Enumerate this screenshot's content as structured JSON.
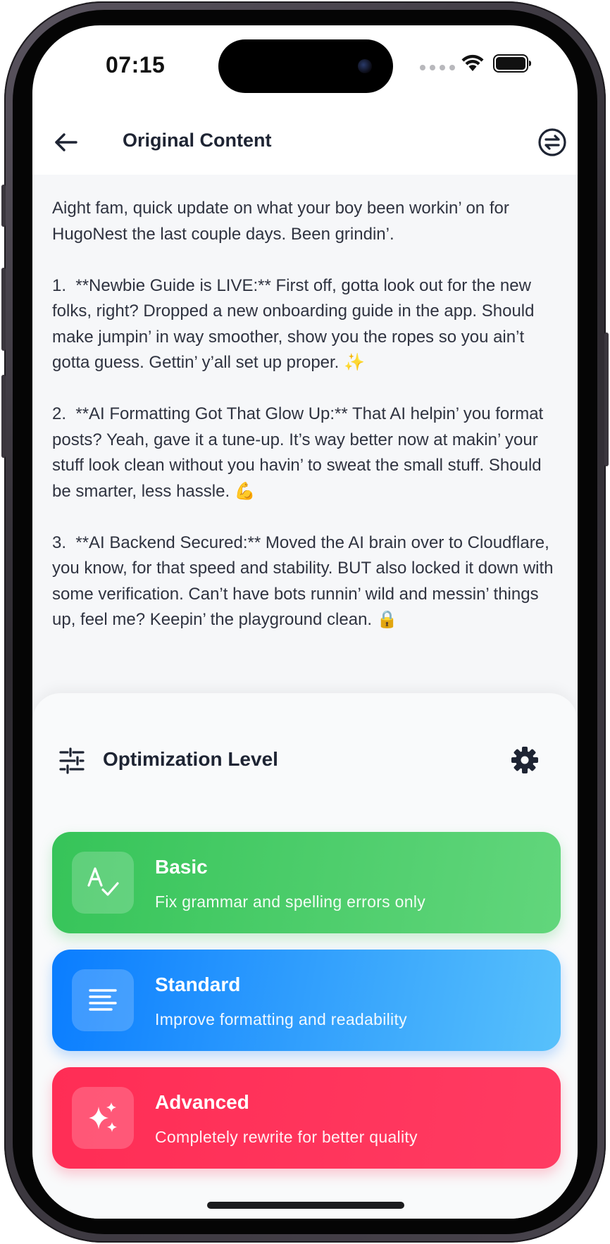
{
  "status_bar": {
    "time": "07:15",
    "icons": [
      "signal-dots-icon",
      "wifi-icon",
      "battery-icon"
    ]
  },
  "header": {
    "title": "Original Content",
    "back_icon": "arrow-left-icon",
    "action_icon": "swap-arrows-icon"
  },
  "content": {
    "text": "Aight fam, quick update on what your boy been workin’ on for HugoNest the last couple days. Been grindin’.\n\n1.  **Newbie Guide is LIVE:** First off, gotta look out for the new folks, right? Dropped a new onboarding guide in the app. Should make jumpin’ in way smoother, show you the ropes so you ain’t gotta guess. Gettin’ y’all set up proper. ✨\n\n2.  **AI Formatting Got That Glow Up:** That AI helpin’ you format posts? Yeah, gave it a tune-up. It’s way better now at makin’ your stuff look clean without you havin’ to sweat the small stuff. Should be smarter, less hassle. 💪\n\n3.  **AI Backend Secured:** Moved the AI brain over to Cloudflare, you know, for that speed and stability. BUT also locked it down with some verification. Can’t have bots runnin’ wild and messin’ things up, feel me? Keepin’ the playground clean. 🔒"
  },
  "optimization": {
    "title": "Optimization Level",
    "left_icon": "sliders-icon",
    "settings_icon": "gear-icon",
    "options": [
      {
        "title": "Basic",
        "description": "Fix grammar and spelling errors only",
        "icon": "spellcheck-icon",
        "color": "#34C759"
      },
      {
        "title": "Standard",
        "description": "Improve formatting and readability",
        "icon": "text-lines-icon",
        "color": "#007AFF"
      },
      {
        "title": "Advanced",
        "description": "Completely rewrite for better quality",
        "icon": "sparkles-icon",
        "color": "#FF2D55"
      }
    ]
  }
}
